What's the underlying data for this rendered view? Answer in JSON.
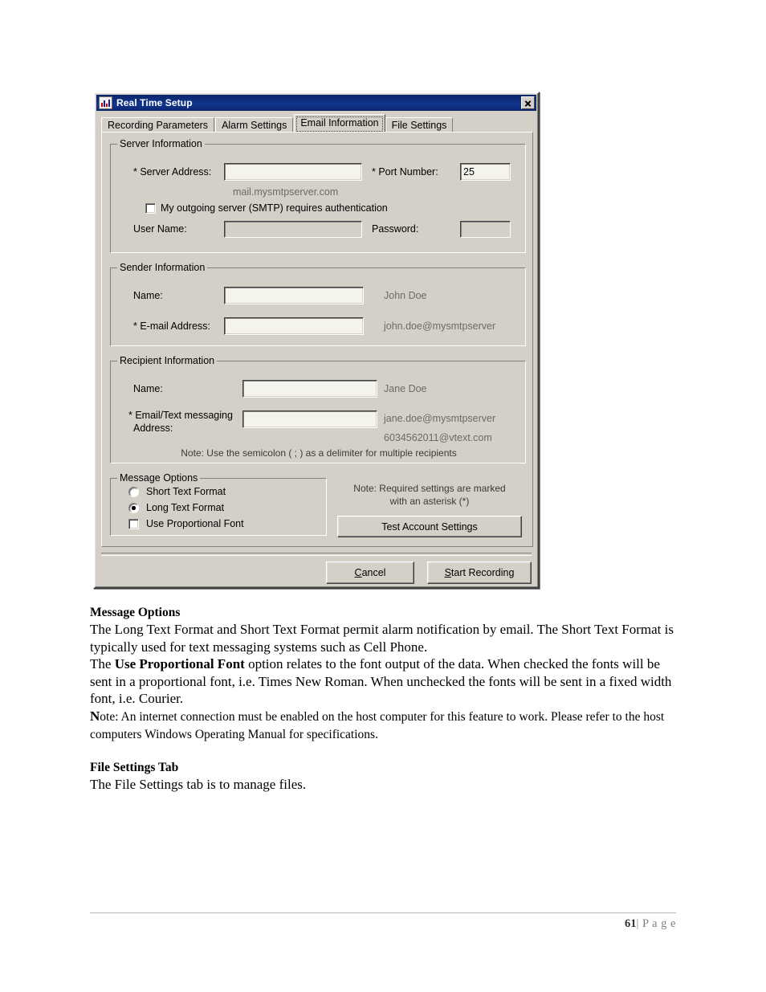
{
  "dialog": {
    "title": "Real Time Setup",
    "icon": "chart-icon",
    "close_label": "✕",
    "tabs": [
      {
        "label": "Recording Parameters",
        "active": false
      },
      {
        "label": "Alarm Settings",
        "active": false
      },
      {
        "label": "Email Information",
        "active": true
      },
      {
        "label": "File Settings",
        "active": false
      }
    ],
    "server_information": {
      "legend": "Server Information",
      "server_address_label": "* Server Address:",
      "server_address_value": "",
      "server_address_hint": "mail.mysmtpserver.com",
      "port_number_label": "* Port Number:",
      "port_number_value": "25",
      "smtp_auth_label": "My outgoing server (SMTP) requires authentication",
      "smtp_auth_checked": false,
      "user_name_label": "User Name:",
      "user_name_value": "",
      "password_label": "Password:",
      "password_value": ""
    },
    "sender_information": {
      "legend": "Sender Information",
      "name_label": "Name:",
      "name_value": "",
      "name_hint": "John Doe",
      "email_label": "* E-mail Address:",
      "email_value": "",
      "email_hint": "john.doe@mysmtpserver"
    },
    "recipient_information": {
      "legend": "Recipient Information",
      "name_label": "Name:",
      "name_value": "",
      "name_hint": "Jane Doe",
      "address_label_line1": "* Email/Text messaging",
      "address_label_line2": "Address:",
      "address_value": "",
      "address_hint1": "jane.doe@mysmtpserver",
      "address_hint2": "6034562011@vtext.com",
      "delimiter_note": "Note: Use the semicolon ( ; ) as a delimiter for multiple recipients"
    },
    "message_options": {
      "legend": "Message Options",
      "short_text_label": "Short Text Format",
      "short_text_selected": false,
      "long_text_label": "Long Text Format",
      "long_text_selected": true,
      "proportional_font_label": "Use Proportional Font",
      "proportional_font_checked": false
    },
    "required_note_line1": "Note: Required settings are marked",
    "required_note_line2": "with an asterisk (*)",
    "test_account_button": "Test Account Settings",
    "cancel_button": {
      "accel": "C",
      "rest": "ancel"
    },
    "start_button": {
      "accel": "S",
      "rest": "tart Recording"
    }
  },
  "document": {
    "heading1": "Message Options",
    "para1": "The Long Text Format and Short Text Format permit alarm notification by email. The Short Text Format is typically used for text messaging systems such as Cell Phone.",
    "para2_pre": "The ",
    "para2_bold": "Use Proportional Font",
    "para2_post": " option relates to the font output of the data. When checked the fonts will be sent in a proportional font, i.e. Times New Roman. When unchecked the fonts will be sent in a fixed width font, i.e. Courier.",
    "para3_bold": "N",
    "para3": "ote: An internet connection must be enabled on the host computer for this feature to work. Please refer to the host computers Windows Operating Manual for specifications.",
    "heading2": "File Settings Tab",
    "para4": "The File Settings tab is to manage files."
  },
  "footer": {
    "page_number": "61",
    "page_word": "| P a g e"
  }
}
